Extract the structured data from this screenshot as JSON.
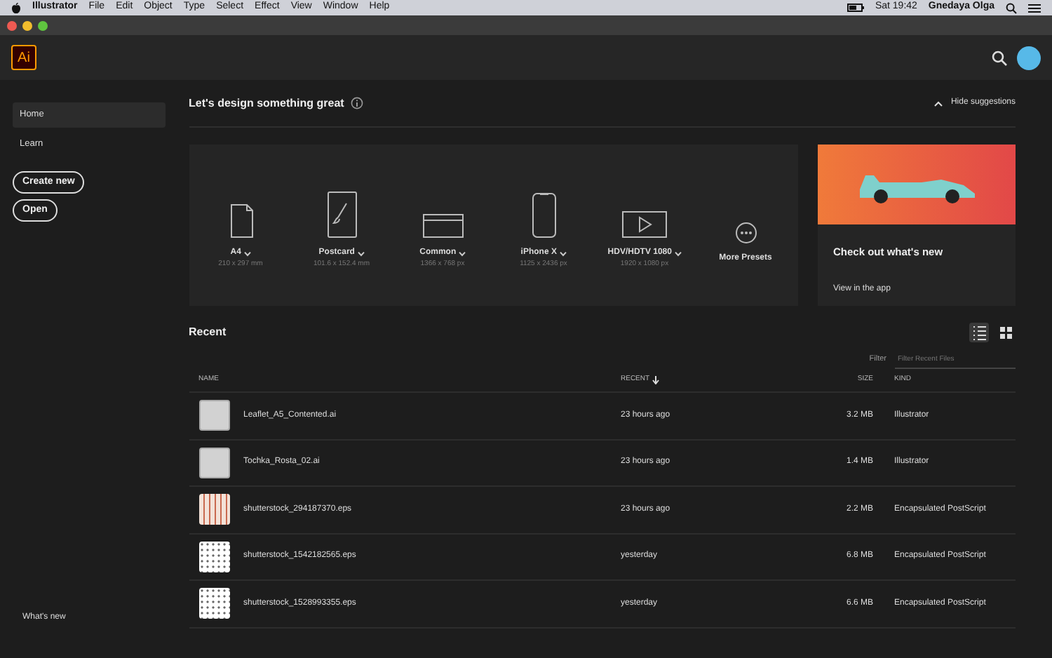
{
  "menu_bar": {
    "app_name": "Illustrator",
    "items": [
      "File",
      "Edit",
      "Object",
      "Type",
      "Select",
      "Effect",
      "View",
      "Window",
      "Help"
    ],
    "clock": "Sat 19:42",
    "user": "Gnedaya Olga"
  },
  "app_header": {
    "logo": "Ai"
  },
  "sidebar": {
    "items": [
      {
        "label": "Home",
        "selected": true
      },
      {
        "label": "Learn",
        "selected": false
      }
    ],
    "buttons": [
      "Create new",
      "Open"
    ],
    "footer_link": "What's new"
  },
  "suggestions": {
    "title": "Let's design something great",
    "toggle": "Hide suggestions",
    "presets": [
      {
        "kind": "page",
        "name": "A4",
        "size": "210 x 297 mm",
        "dropdown": true
      },
      {
        "kind": "tablet",
        "name": "Postcard",
        "size": "101.6 x 152.4 mm",
        "dropdown": true
      },
      {
        "kind": "screen",
        "name": "Common",
        "size": "1366 x 768 px",
        "dropdown": true
      },
      {
        "kind": "phone",
        "name": "iPhone X",
        "size": "1125 x 2436 px",
        "dropdown": true
      },
      {
        "kind": "video",
        "name": "HDV/HDTV 1080",
        "size": "1920 x 1080 px",
        "dropdown": true
      },
      {
        "kind": "more",
        "name": "More Presets",
        "dropdown": false
      }
    ],
    "promo": {
      "title": "Check out what's new",
      "link": "View in the app"
    }
  },
  "recent": {
    "title": "Recent",
    "view_modes": [
      {
        "kind": "list",
        "selected": true
      },
      {
        "kind": "grid",
        "selected": false
      }
    ],
    "filter": {
      "label": "Filter",
      "placeholder": "Filter Recent Files"
    },
    "columns": [
      "NAME",
      "RECENT",
      "SIZE",
      "KIND"
    ],
    "rows": [
      {
        "kind": "blank",
        "name": "Leaflet_A5_Contented.ai",
        "recent": "23 hours ago",
        "size": "3.2 MB",
        "file_kind": "Illustrator"
      },
      {
        "kind": "blank",
        "name": "Tochka_Rosta_02.ai",
        "recent": "23 hours ago",
        "size": "1.4 MB",
        "file_kind": "Illustrator"
      },
      {
        "kind": "red",
        "name": "shutterstock_294187370.eps",
        "recent": "23 hours ago",
        "size": "2.2 MB",
        "file_kind": "Encapsulated PostScript"
      },
      {
        "kind": "grid",
        "name": "shutterstock_1542182565.eps",
        "recent": "yesterday",
        "size": "6.8 MB",
        "file_kind": "Encapsulated PostScript"
      },
      {
        "kind": "grid",
        "name": "shutterstock_1528993355.eps",
        "recent": "yesterday",
        "size": "6.6 MB",
        "file_kind": "Encapsulated PostScript"
      }
    ]
  }
}
